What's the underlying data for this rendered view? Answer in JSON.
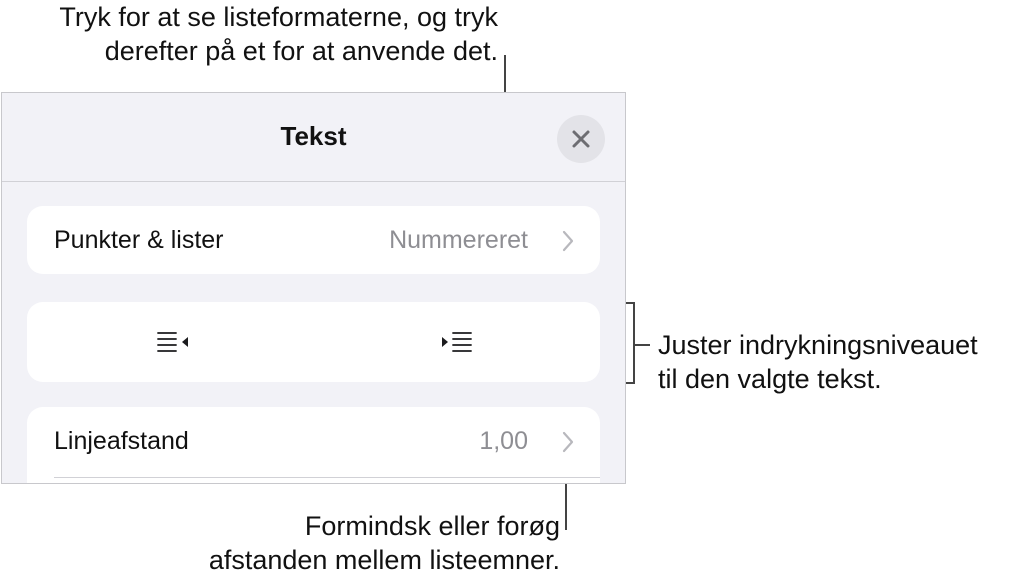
{
  "callouts": {
    "top": [
      "Tryk for at se listeformaterne, og tryk",
      "derefter på et for at anvende det."
    ],
    "right": [
      "Juster indrykningsniveauet",
      "til den valgte tekst."
    ],
    "bottom": [
      "Formindsk eller forøg",
      "afstanden mellem listeemner."
    ]
  },
  "panel": {
    "title": "Tekst",
    "close_icon": "xmark-icon"
  },
  "rows": {
    "bullets": {
      "label": "Punkter & lister",
      "value": "Nummereret"
    },
    "indent": {
      "outdent_icon": "decrease-indent-icon",
      "indent_icon": "increase-indent-icon"
    },
    "spacing": {
      "label": "Linjeafstand",
      "value": "1,00"
    }
  },
  "colors": {
    "panel_bg": "#f2f2f7",
    "row_bg": "#ffffff",
    "secondary_text": "#8e8e93",
    "close_bg": "#e3e3e8"
  }
}
